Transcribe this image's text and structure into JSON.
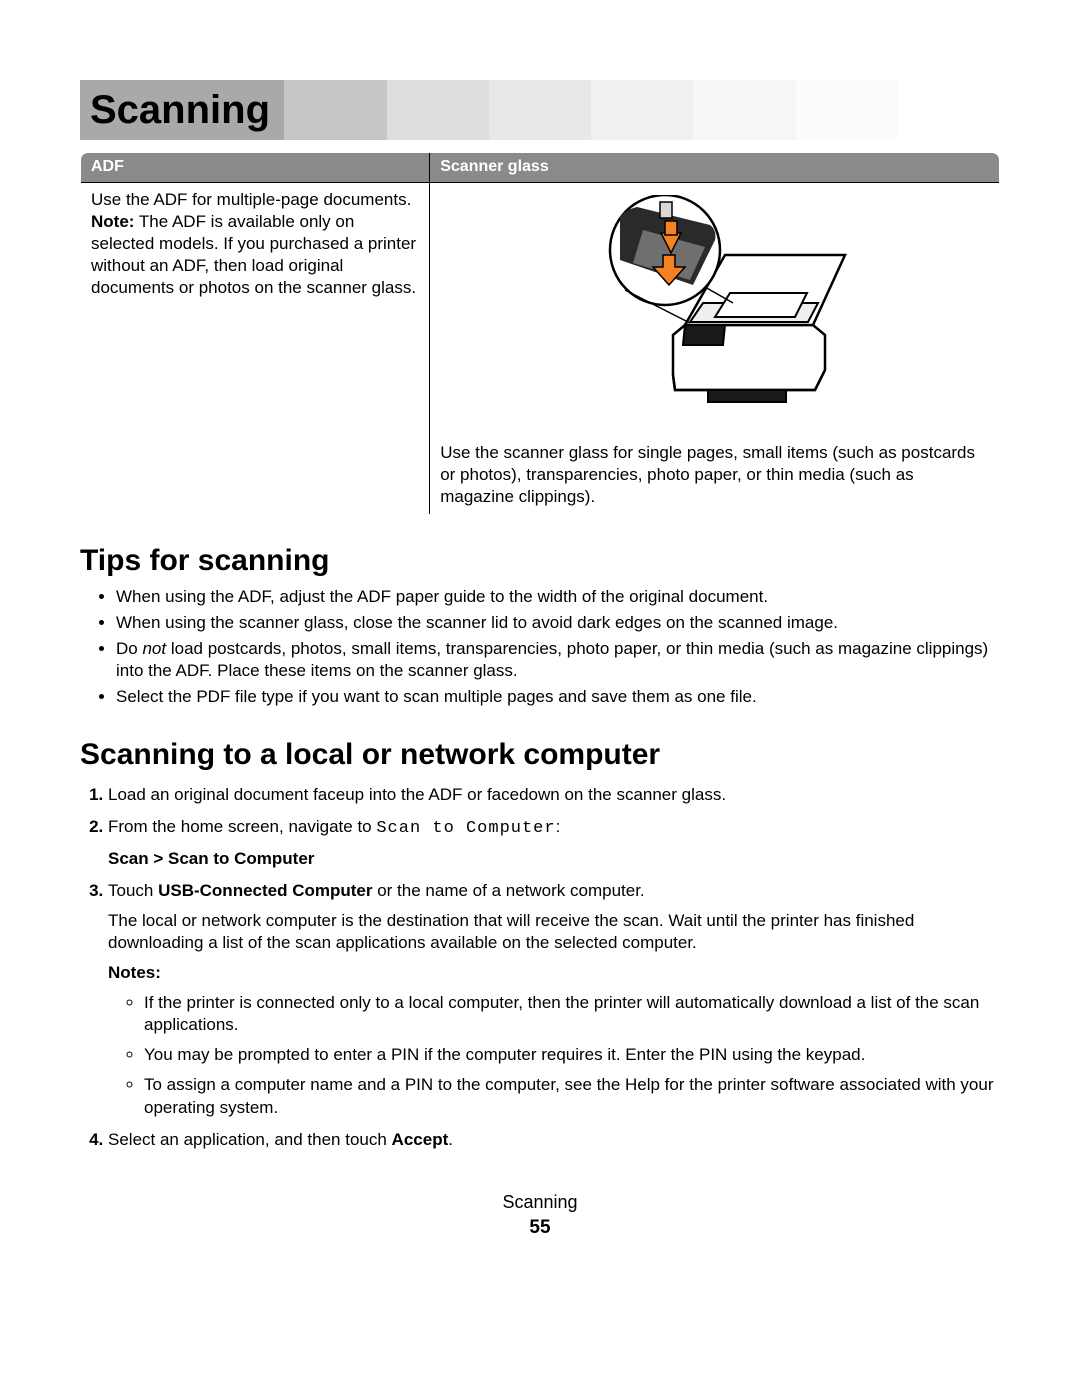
{
  "title": "Scanning",
  "table": {
    "header_adf": "ADF",
    "header_scanner": "Scanner glass",
    "adf_use": "Use the ADF for multiple-page documents.",
    "adf_note_label": "Note:",
    "adf_note_body": " The ADF is available only on selected models. If you purchased a printer without an ADF, then load original documents or photos on the scanner glass.",
    "scanner_use": "Use the scanner glass for single pages, small items (such as postcards or photos), transparencies, photo paper, or thin media (such as magazine clippings)."
  },
  "tips": {
    "heading": "Tips for scanning",
    "items": [
      "When using the ADF, adjust the ADF paper guide to the width of the original document.",
      "When using the scanner glass, close the scanner lid to avoid dark edges on the scanned image.",
      "Do |not| load postcards, photos, small items, transparencies, photo paper, or thin media (such as magazine clippings) into the ADF. Place these items on the scanner glass.",
      "Select the PDF file type if you want to scan multiple pages and save them as one file."
    ]
  },
  "scanto": {
    "heading": "Scanning to a local or network computer",
    "step1": "Load an original document faceup into the ADF or facedown on the scanner glass.",
    "step2_a": "From the home screen, navigate to ",
    "step2_mono": "Scan to Computer",
    "step2_b": ":",
    "step2_path": "Scan > Scan to Computer",
    "step3_a": "Touch ",
    "step3_strong": "USB-Connected Computer",
    "step3_b": " or the name of a network computer.",
    "step3_para": "The local or network computer is the destination that will receive the scan. Wait until the printer has finished downloading a list of the scan applications available on the selected computer.",
    "notes_label": "Notes:",
    "notes": [
      "If the printer is connected only to a local computer, then the printer will automatically download a list of the scan applications.",
      "You may be prompted to enter a PIN if the computer requires it. Enter the PIN using the keypad.",
      "To assign a computer name and a PIN to the computer, see the Help for the printer software associated with your operating system."
    ],
    "step4_a": "Select an application, and then touch ",
    "step4_strong": "Accept",
    "step4_b": "."
  },
  "footer": {
    "chapter": "Scanning",
    "page": "55"
  }
}
